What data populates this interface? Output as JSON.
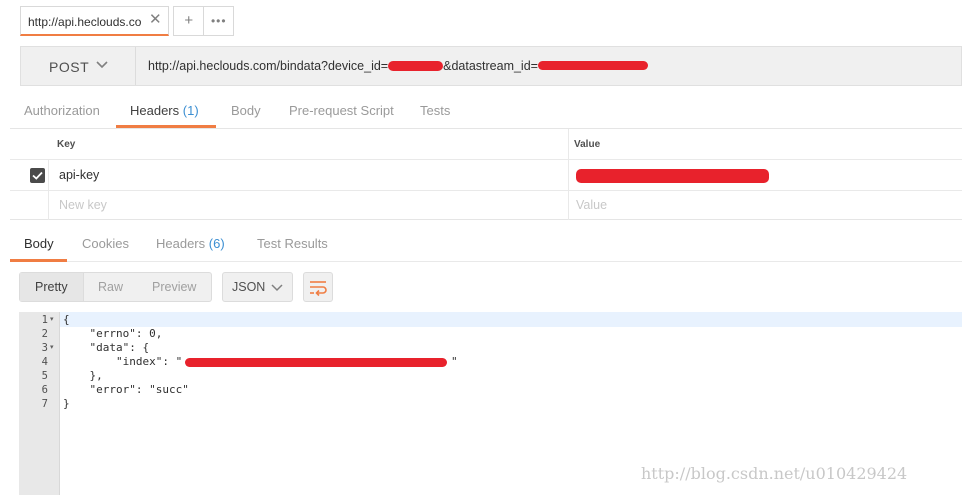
{
  "tabs": {
    "active_title": "http://api.heclouds.co",
    "close_glyph": "✕",
    "add_glyph": "+",
    "more_glyph": "•••"
  },
  "request": {
    "method": "POST",
    "url_prefix": "http://api.heclouds.com/bindata?device_id=",
    "url_mid": "&datastream_id="
  },
  "request_tabs": [
    {
      "label": "Authorization"
    },
    {
      "label": "Headers",
      "count": "(1)"
    },
    {
      "label": "Body"
    },
    {
      "label": "Pre-request Script"
    },
    {
      "label": "Tests"
    }
  ],
  "headers_table": {
    "key_header": "Key",
    "value_header": "Value",
    "rows": [
      {
        "key": "api-key",
        "checked": true
      }
    ],
    "new_key_placeholder": "New key",
    "new_value_placeholder": "Value"
  },
  "response_tabs": [
    {
      "label": "Body"
    },
    {
      "label": "Cookies"
    },
    {
      "label": "Headers",
      "count": "(6)"
    },
    {
      "label": "Test Results"
    }
  ],
  "viewer": {
    "modes": [
      "Pretty",
      "Raw",
      "Preview"
    ],
    "format": "JSON"
  },
  "code_lines": [
    {
      "num": "1",
      "fold": "▾",
      "text": "{"
    },
    {
      "num": "2",
      "fold": "",
      "text": "    \"errno\": 0,"
    },
    {
      "num": "3",
      "fold": "▾",
      "text": "    \"data\": {"
    },
    {
      "num": "4",
      "fold": "",
      "text": "        \"index\": \""
    },
    {
      "num": "5",
      "fold": "",
      "text": "    },"
    },
    {
      "num": "6",
      "fold": "",
      "text": "    \"error\": \"succ\""
    },
    {
      "num": "7",
      "fold": "",
      "text": "}"
    }
  ],
  "code_line4_end": "\"",
  "watermark": "http://blog.csdn.net/u010429424",
  "colors": {
    "accent": "#f07d43",
    "count_blue": "#3c8fd2",
    "redaction": "#e8222c"
  }
}
